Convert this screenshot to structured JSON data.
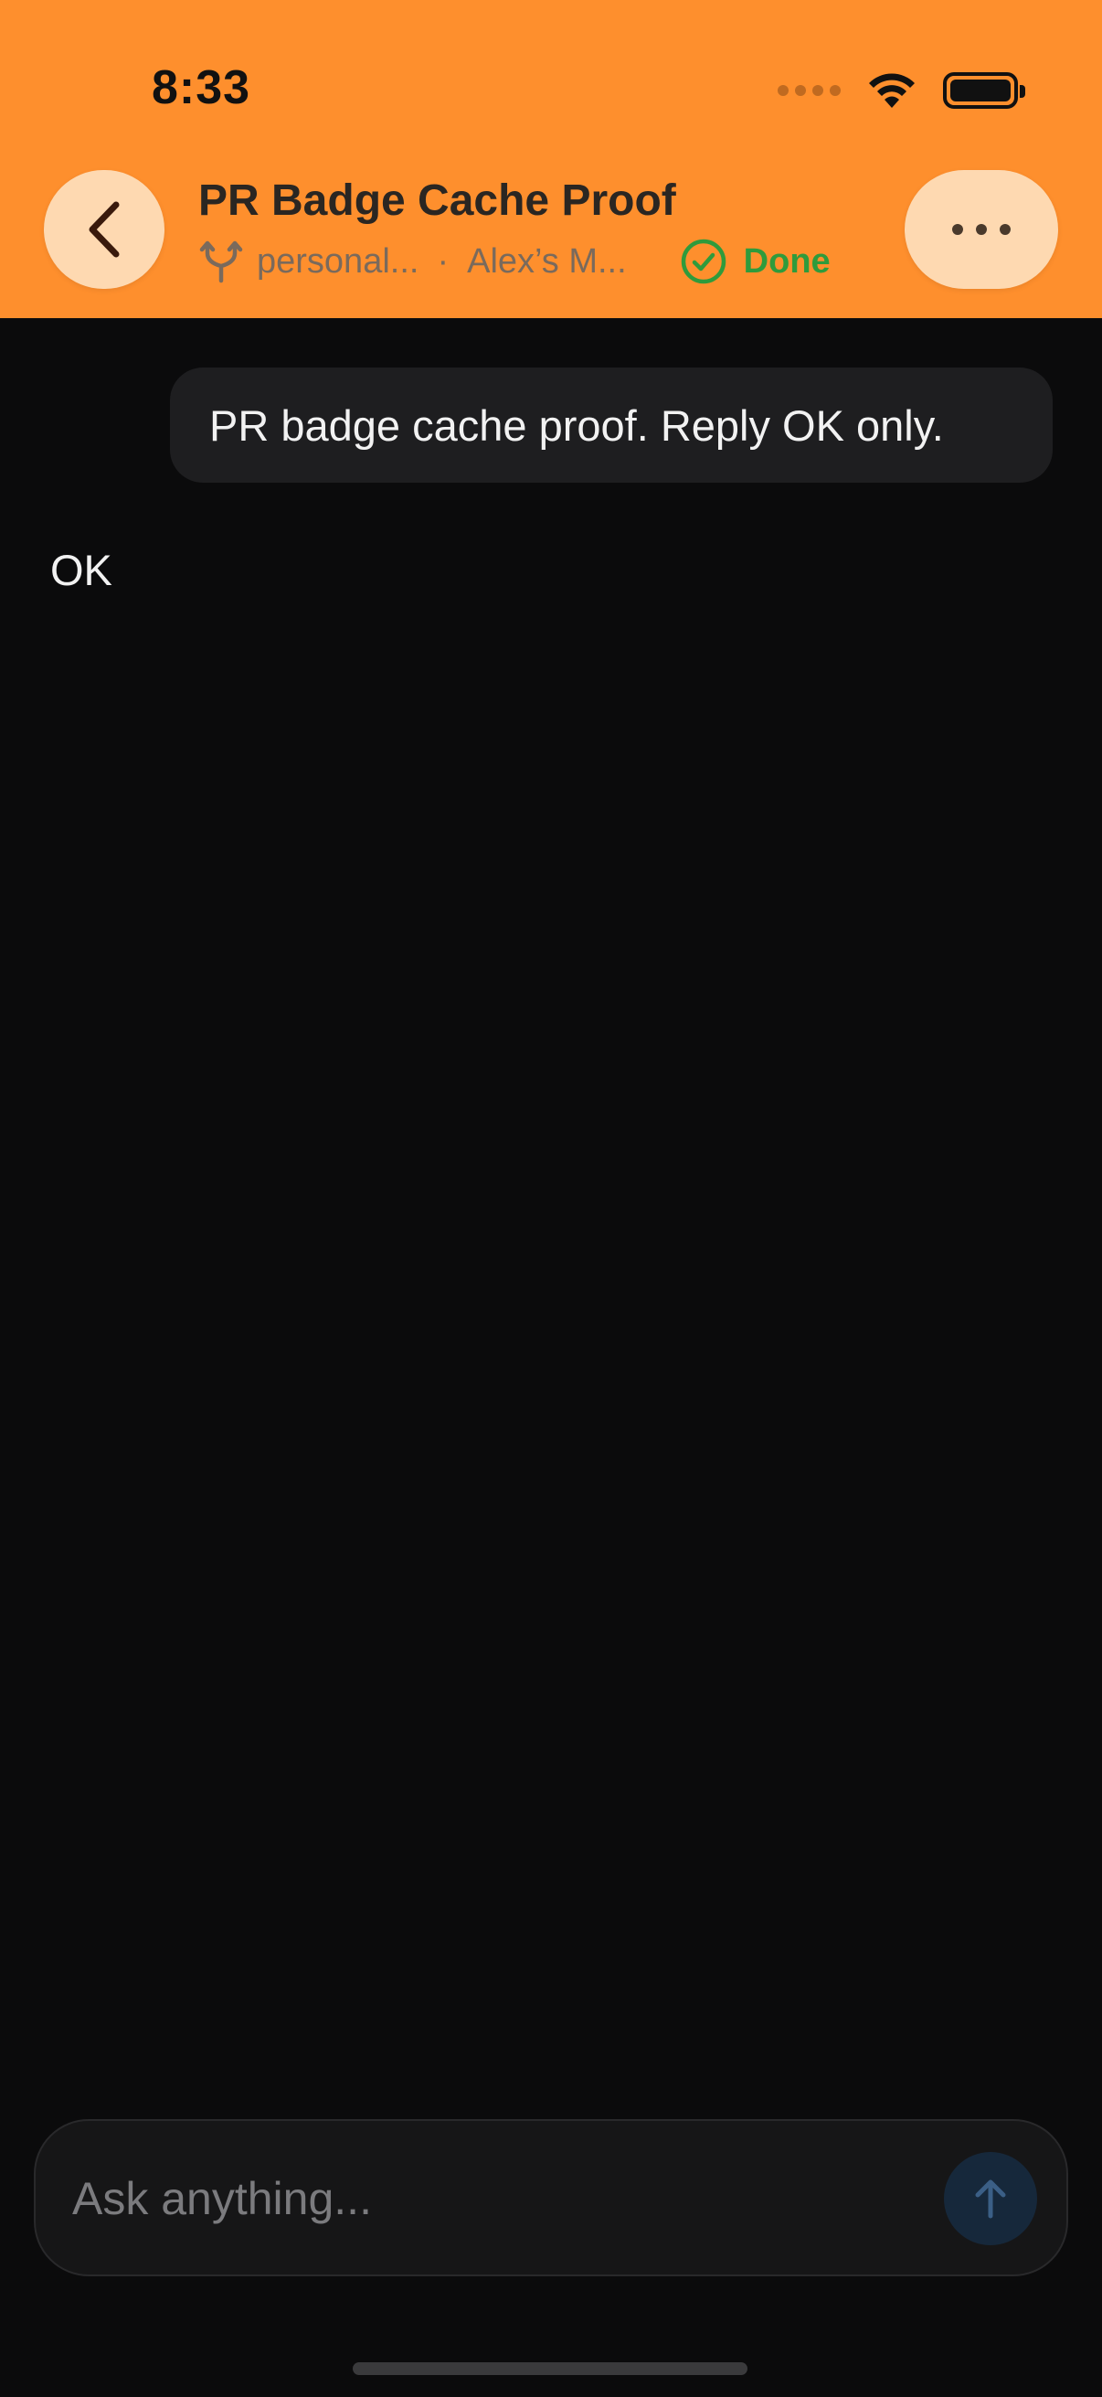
{
  "status_bar": {
    "time": "8:33"
  },
  "header": {
    "title": "PR Badge Cache Proof",
    "branch": "personal...",
    "separator": "·",
    "machine": "Alex’s M...",
    "status_label": "Done",
    "accent_color": "#fe8f2d",
    "status_color": "#2f9b3c"
  },
  "messages": [
    {
      "role": "user",
      "text": "PR badge cache proof. Reply OK only."
    },
    {
      "role": "assistant",
      "text": "OK"
    }
  ],
  "composer": {
    "placeholder": "Ask anything...",
    "value": ""
  },
  "icons": {
    "back": "chevron-left-icon",
    "more": "ellipsis-icon",
    "branch": "git-branch-icon",
    "status": "check-circle-icon",
    "send": "arrow-up-icon"
  }
}
